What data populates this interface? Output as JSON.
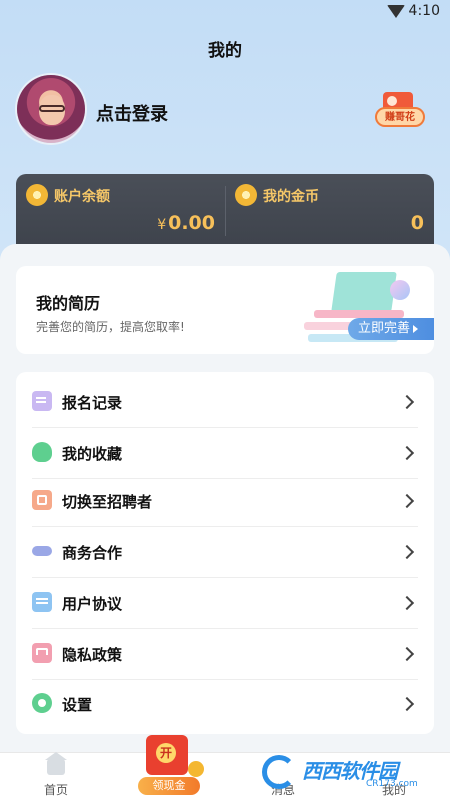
{
  "status_bar": {
    "time": "4:10"
  },
  "header": {
    "title": "我的"
  },
  "profile": {
    "login_text": "点击登录",
    "badge_label": "赚哥花"
  },
  "balance": {
    "account": {
      "label": "账户余额",
      "currency": "¥",
      "amount": "0.00"
    },
    "coins": {
      "label": "我的金币",
      "amount": "0"
    }
  },
  "resume": {
    "title": "我的简历",
    "subtitle": "完善您的简历，提高您取率!",
    "button": "立即完善"
  },
  "menu": {
    "items": [
      {
        "label": "报名记录",
        "icon": "register-record-icon"
      },
      {
        "label": "我的收藏",
        "icon": "favorites-icon"
      },
      {
        "label": "切换至招聘者",
        "icon": "switch-role-icon"
      },
      {
        "label": "商务合作",
        "icon": "handshake-icon"
      },
      {
        "label": "用户协议",
        "icon": "agreement-icon"
      },
      {
        "label": "隐私政策",
        "icon": "privacy-icon"
      },
      {
        "label": "设置",
        "icon": "settings-icon"
      }
    ]
  },
  "bottom_nav": {
    "home": "首页",
    "cash": {
      "seal": "开",
      "label": "领现金"
    },
    "messages": "消息",
    "me": "我的"
  },
  "watermark": {
    "text": "西西软件园",
    "sub": "CR173.com"
  },
  "colors": {
    "gold": "#f7c05a",
    "card_dark": "#434851",
    "accent_blue": "#4e8ee0"
  }
}
